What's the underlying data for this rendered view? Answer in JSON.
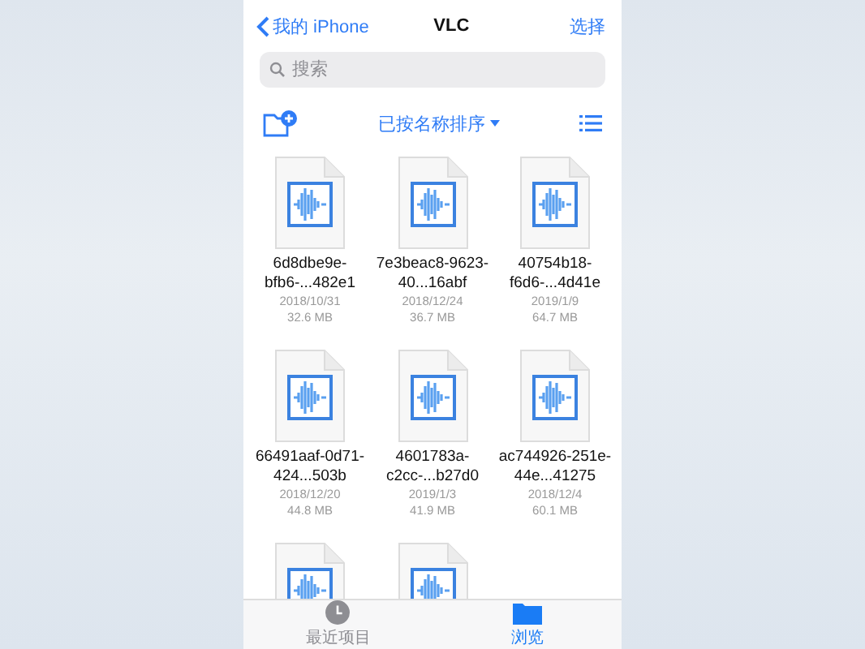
{
  "nav": {
    "back": "我的 iPhone",
    "title": "VLC",
    "action": "选择"
  },
  "search": {
    "placeholder": "搜索"
  },
  "toolbar": {
    "sort": "已按名称排序"
  },
  "files": [
    {
      "kind": "audio",
      "name": "6d8dbe9e-bfb6-...482e1",
      "date": "2018/10/31",
      "size": "32.6 MB"
    },
    {
      "kind": "audio",
      "name": "7e3beac8-9623-40...16abf",
      "date": "2018/12/24",
      "size": "36.7 MB"
    },
    {
      "kind": "audio",
      "name": "40754b18-f6d6-...4d41e",
      "date": "2019/1/9",
      "size": "64.7 MB"
    },
    {
      "kind": "audio",
      "name": "66491aaf-0d71-424...503b",
      "date": "2018/12/20",
      "size": "44.8 MB"
    },
    {
      "kind": "audio",
      "name": "4601783a-c2cc-...b27d0",
      "date": "2019/1/3",
      "size": "41.9 MB"
    },
    {
      "kind": "audio",
      "name": "ac744926-251e-44e...41275",
      "date": "2018/12/4",
      "size": "60.1 MB"
    },
    {
      "kind": "audio"
    },
    {
      "kind": "audio"
    }
  ],
  "tabs": [
    {
      "kind": "recents",
      "label": "最近项目",
      "selected": false
    },
    {
      "kind": "browse",
      "label": "浏览",
      "selected": true
    }
  ]
}
